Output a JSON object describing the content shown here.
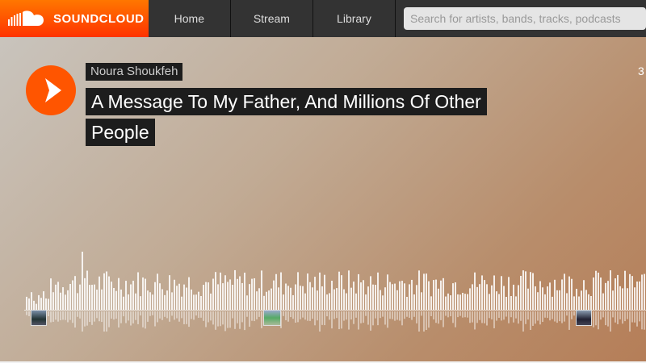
{
  "header": {
    "logo_text": "SOUNDCLOUD",
    "nav": [
      "Home",
      "Stream",
      "Library"
    ],
    "search_placeholder": "Search for artists, bands, tracks, podcasts"
  },
  "track": {
    "artist": "Noura Shoukfeh",
    "title": "A Message To My Father, And Millions Of Other People",
    "date_fragment": "3"
  },
  "colors": {
    "brand": "#ff5500",
    "topbar": "#333333",
    "label_bg": "#1d1d1d",
    "waveform": "#ffffff"
  },
  "icons": [
    "soundcloud-logo-icon",
    "play-icon"
  ]
}
